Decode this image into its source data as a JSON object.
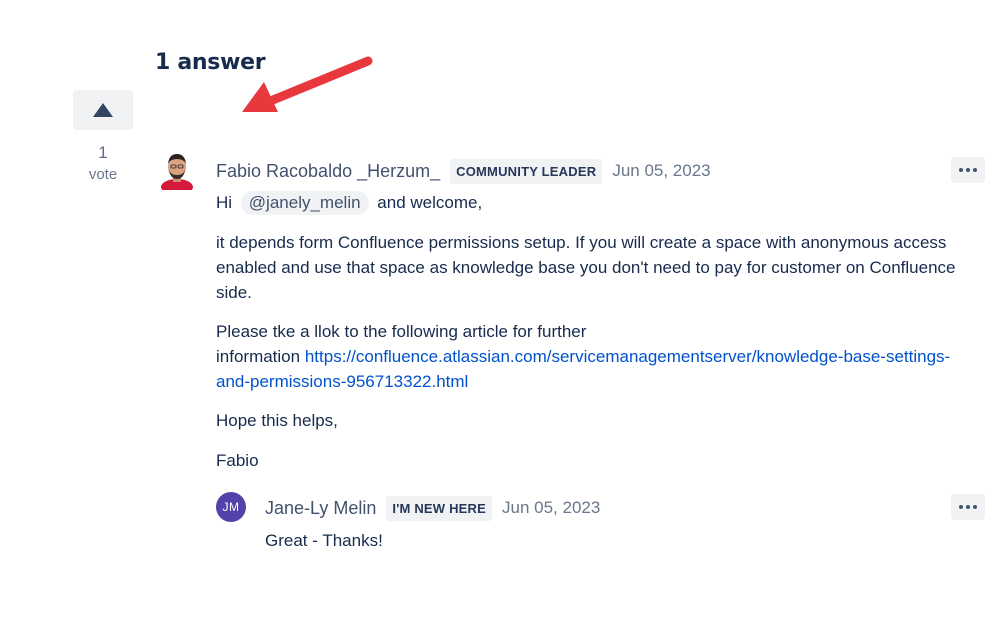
{
  "answers": {
    "heading": "1 answer"
  },
  "vote": {
    "count": "1",
    "label": "vote"
  },
  "answer": {
    "author": "Fabio Racobaldo _Herzum_",
    "badge": "COMMUNITY LEADER",
    "date": "Jun 05, 2023",
    "greeting_prefix": "Hi",
    "mention": "@janely_melin",
    "greeting_suffix": "and welcome,",
    "paragraph1": "it depends form Confluence permissions setup. If you will create a space with anonymous access enabled and use that space as knowledge base you don't need to pay for customer on Confluence side.",
    "paragraph2_line1": "Please tke a llok to the following article for further",
    "paragraph2_prefix": "information",
    "link_part1": "https://confluence.atlassian.com/servicemanagementserver/knowledge-base-settings-",
    "link_part2": "and-permissions-956713322.html",
    "closing": "Hope this helps,",
    "signature": "Fabio"
  },
  "reply": {
    "initials": "JM",
    "author": "Jane-Ly Melin",
    "badge": "I'M NEW HERE",
    "date": "Jun 05, 2023",
    "text": "Great - Thanks!"
  },
  "icons": {
    "upvote": "triangle-up-icon",
    "more": "ellipsis-icon",
    "annotation": "red-arrow-icon"
  },
  "colors": {
    "arrow": "#e8373d",
    "link": "#0052cc",
    "reply_avatar": "#5243aa",
    "badge_bg": "#f1f2f4"
  }
}
